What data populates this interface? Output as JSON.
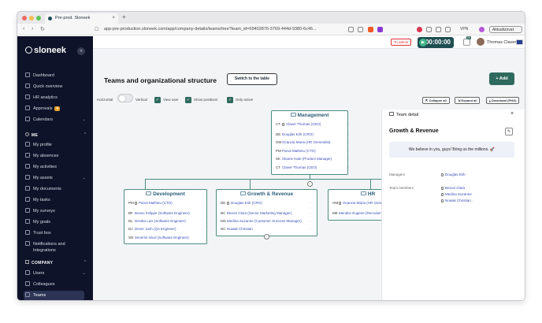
{
  "browser": {
    "tab_title": "Pre-prod. Sloneek",
    "tab_close": "×",
    "new_tab": "+",
    "url": "app-pre-production.sloneek.com/app/company-details/teams/tree?team_id=69402876-3769-444d-9380-6c46...",
    "vpn": "VPN",
    "update_button": "Aktualizovat"
  },
  "sidebar": {
    "logo": "sloneek",
    "collapse": "«",
    "items": [
      {
        "label": "Dashboard"
      },
      {
        "label": "Quick overview"
      },
      {
        "label": "HR analytics"
      },
      {
        "label": "Approvals",
        "badge": "9"
      },
      {
        "label": "Calendars"
      }
    ],
    "me_section": "ME",
    "me_items": [
      {
        "label": "My profile"
      },
      {
        "label": "My absences"
      },
      {
        "label": "My activities"
      },
      {
        "label": "My assets"
      },
      {
        "label": "My documents"
      },
      {
        "label": "My tasks"
      },
      {
        "label": "My surveys"
      },
      {
        "label": "My goals"
      },
      {
        "label": "Trust box"
      },
      {
        "label": "Notifications and Integrations"
      }
    ],
    "company_section": "COMPANY",
    "company_items": [
      {
        "label": "Users"
      },
      {
        "label": "Colleagues"
      },
      {
        "label": "Teams"
      }
    ]
  },
  "header": {
    "admin_badge": "To admin",
    "timer": "00:00:00",
    "notif_count": "29",
    "user_name": "Thomas Claver"
  },
  "page": {
    "title": "Teams and organizational structure",
    "switch_button": "Switch to the table",
    "add_button": "+ Add",
    "controls": {
      "horizontal": "Horizontal",
      "vertical": "Vertical",
      "view_user": "View user",
      "show_positions": "Show positions",
      "only_active": "Only active",
      "collapse_all": "Collapse all",
      "expand_all": "Expand all",
      "download": "Download (PNG)"
    }
  },
  "teams": {
    "management": {
      "name": "Management",
      "members": [
        {
          "code": "CT",
          "name": "Claver Thomas (CEO)"
        },
        {
          "code": "DE",
          "name": "Douglas Erik (CRO)"
        },
        {
          "code": "OM",
          "name": "Ocancia Maria (HR Generalist)"
        },
        {
          "code": "PM",
          "name": "Panot Mathieu (CTO)"
        },
        {
          "code": "SK",
          "name": "Sloane Kate (Product Manager)"
        },
        {
          "code": "CT",
          "name": "Claver Thomas (CEO)"
        }
      ]
    },
    "development": {
      "name": "Development",
      "members": [
        {
          "code": "PM",
          "name": "Panot Mathieu (CTO)"
        },
        {
          "code": "BF",
          "name": "Bosso Felippe (Software Engineer)"
        },
        {
          "code": "DL",
          "name": "Devitta Luis (Software Engineer)"
        },
        {
          "code": "DJ",
          "name": "Dever Josh (QA Engineer)"
        },
        {
          "code": "SN",
          "name": "Severini Nicol (Software Engineer)"
        }
      ]
    },
    "growth": {
      "name": "Growth & Revenue",
      "members": [
        {
          "code": "DE",
          "name": "Douglas Erik (CRO)"
        },
        {
          "code": "BC",
          "name": "Beruni Clara (Senior Marketing Manager)"
        },
        {
          "code": "MS",
          "name": "Medina Suzanne (Customer Success Manager)"
        },
        {
          "code": "NC",
          "name": "Nowak Christian"
        }
      ]
    },
    "hr": {
      "name": "HR",
      "members": [
        {
          "code": "OM",
          "name": "Ocancia Maria (HR Generalist)"
        },
        {
          "code": "ME",
          "name": "Mendez Eugene (Recruiter)"
        }
      ]
    }
  },
  "panel": {
    "title": "Team detail",
    "team_name": "Growth & Revenue",
    "motto": "We believe in you, guys! Bring us the millions. 🚀",
    "managers_label": "Managers",
    "managers": [
      "Douglas Erik"
    ],
    "members_label": "Team members",
    "members": [
      "Beruni Clara",
      "Medina Suzanne",
      "Nowak Christian"
    ]
  }
}
